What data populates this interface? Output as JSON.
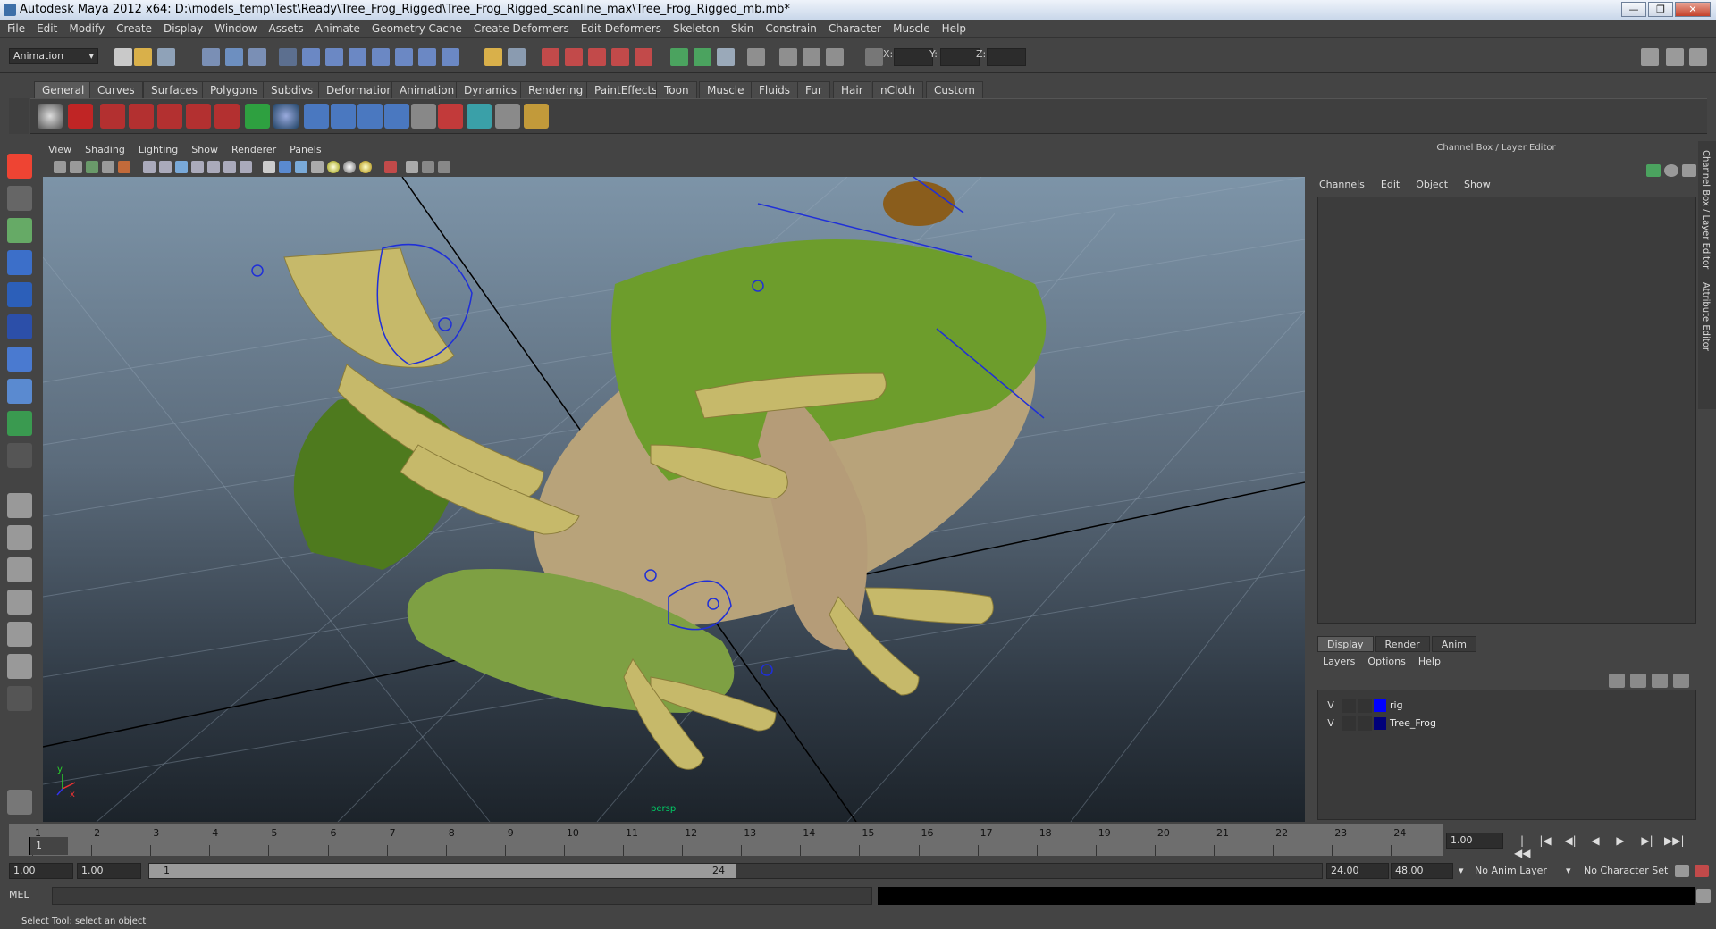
{
  "window": {
    "title": "Autodesk Maya 2012 x64: D:\\models_temp\\Test\\Ready\\Tree_Frog_Rigged\\Tree_Frog_Rigged_scanline_max\\Tree_Frog_Rigged_mb.mb*",
    "btn_min": "—",
    "btn_max": "❐",
    "btn_close": "✕"
  },
  "menubar": [
    "File",
    "Edit",
    "Modify",
    "Create",
    "Display",
    "Window",
    "Assets",
    "Animate",
    "Geometry Cache",
    "Create Deformers",
    "Edit Deformers",
    "Skeleton",
    "Skin",
    "Constrain",
    "Character",
    "Muscle",
    "Help"
  ],
  "statusline": {
    "mode": "Animation",
    "x_label": "X:",
    "y_label": "Y:",
    "z_label": "Z:"
  },
  "shelf_tabs": [
    "General",
    "Curves",
    "Surfaces",
    "Polygons",
    "Subdivs",
    "Deformation",
    "Animation",
    "Dynamics",
    "Rendering",
    "PaintEffects",
    "Toon",
    "Muscle",
    "Fluids",
    "Fur",
    "Hair",
    "nCloth",
    "Custom"
  ],
  "shelf_active": "General",
  "panel_menu": [
    "View",
    "Shading",
    "Lighting",
    "Show",
    "Renderer",
    "Panels"
  ],
  "viewport": {
    "camera_label": "persp",
    "axis_x": "x",
    "axis_y": "y"
  },
  "channel_box": {
    "title": "Channel Box / Layer Editor",
    "menu": [
      "Channels",
      "Edit",
      "Object",
      "Show"
    ]
  },
  "layer_editor": {
    "tabs": [
      "Display",
      "Render",
      "Anim"
    ],
    "active_tab": "Display",
    "menu": [
      "Layers",
      "Options",
      "Help"
    ],
    "layers": [
      {
        "visible": "V",
        "name": "rig",
        "color": "#0000ff"
      },
      {
        "visible": "V",
        "name": "Tree_Frog",
        "color": "#00007a"
      }
    ]
  },
  "side_tabs": [
    "Channel Box / Layer Editor",
    "Attribute Editor"
  ],
  "timeline": {
    "ticks": [
      "1",
      "2",
      "3",
      "4",
      "5",
      "6",
      "7",
      "8",
      "9",
      "10",
      "11",
      "12",
      "13",
      "14",
      "15",
      "16",
      "17",
      "18",
      "19",
      "20",
      "21",
      "22",
      "23",
      "24"
    ],
    "current_frame": "1",
    "time_field": "1.00"
  },
  "playback": [
    "|◀◀",
    "|◀",
    "◀|",
    "◀",
    "▶",
    "▶|",
    "▶▶|"
  ],
  "range": {
    "start": "1.00",
    "playback_start": "1.00",
    "handle_start": "1",
    "handle_end": "24",
    "playback_end": "24.00",
    "end": "48.00",
    "anim_layer": "No Anim Layer",
    "character_set": "No Character Set"
  },
  "cmdline": {
    "label": "MEL"
  },
  "helpline": "Select Tool: select an object"
}
